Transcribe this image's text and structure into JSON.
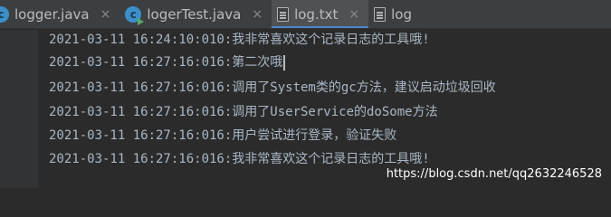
{
  "tabs": [
    {
      "label": "logger.java",
      "icon": "java-class-icon",
      "closable": true
    },
    {
      "label": "logerTest.java",
      "icon": "java-runnable-class-icon",
      "closable": true
    },
    {
      "label": "log.txt",
      "icon": "text-file-icon",
      "closable": true,
      "active": true
    },
    {
      "label": "log",
      "icon": "text-file-icon",
      "closable": false
    }
  ],
  "close_glyph": "×",
  "lines": [
    "2021-03-11 16:24:10:010:我非常喜欢这个记录日志的工具哦!",
    "2021-03-11 16:27:16:016:第二次哦",
    "2021-03-11 16:27:16:016:调用了System类的gc方法，建议启动垃圾回收",
    "2021-03-11 16:27:16:016:调用了UserService的doSome方法",
    "2021-03-11 16:27:16:016:用户尝试进行登录，验证失败",
    "2021-03-11 16:27:16:016:我非常喜欢这个记录日志的工具哦!"
  ],
  "watermark": "https://blog.csdn.net/qq2632246528",
  "colors": {
    "background": "#2b2b2b",
    "text": "#a9b7c6",
    "tab_active_underline": "#4a88c7",
    "class_icon": "#3d8fc9"
  }
}
